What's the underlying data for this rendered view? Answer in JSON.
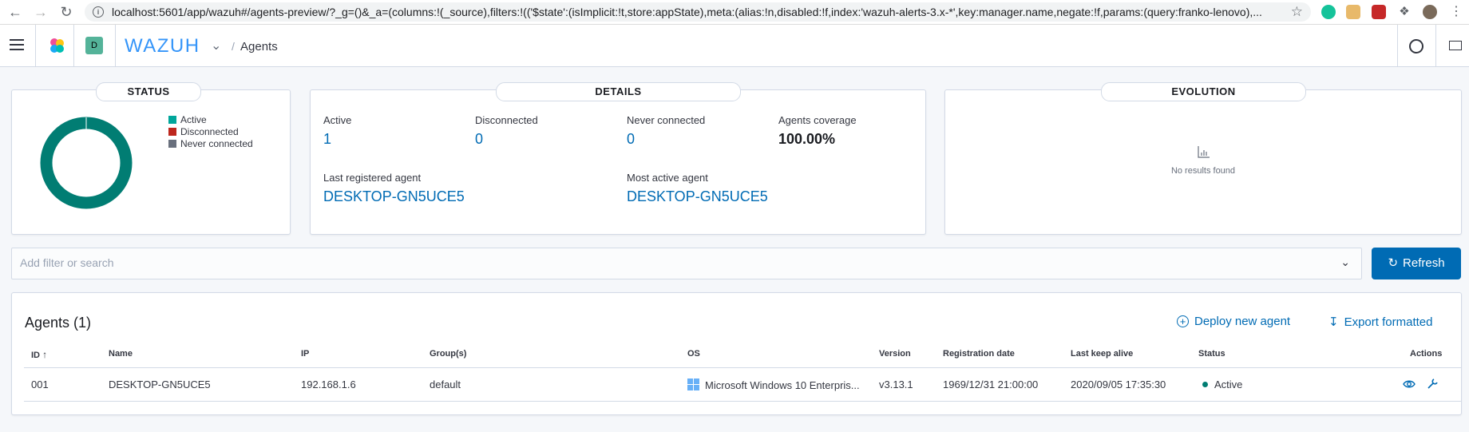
{
  "browser": {
    "url": "localhost:5601/app/wazuh#/agents-preview/?_g=()&_a=(columns:!(_source),filters:!(('$state':(isImplicit:!t,store:appState),meta:(alias:!n,disabled:!f,index:'wazuh-alerts-3.x-*',key:manager.name,negate:!f,params:(query:franko-lenovo),..."
  },
  "header": {
    "space_initial": "D",
    "brand": "WAZUH",
    "breadcrumb": "Agents"
  },
  "status_panel": {
    "title": "STATUS",
    "legend": [
      {
        "label": "Active",
        "color": "#00a69b"
      },
      {
        "label": "Disconnected",
        "color": "#bd271e"
      },
      {
        "label": "Never connected",
        "color": "#69707d"
      }
    ],
    "donut": {
      "active": 1,
      "disconnected": 0,
      "never_connected": 0,
      "color": "#017d73"
    }
  },
  "details_panel": {
    "title": "DETAILS",
    "stats": [
      {
        "label": "Active",
        "value": "1"
      },
      {
        "label": "Disconnected",
        "value": "0"
      },
      {
        "label": "Never connected",
        "value": "0"
      },
      {
        "label": "Agents coverage",
        "value": "100.00%"
      }
    ],
    "last_registered_label": "Last registered agent",
    "last_registered_value": "DESKTOP-GN5UCE5",
    "most_active_label": "Most active agent",
    "most_active_value": "DESKTOP-GN5UCE5"
  },
  "evolution_panel": {
    "title": "EVOLUTION",
    "empty_text": "No results found"
  },
  "search": {
    "placeholder": "Add filter or search"
  },
  "refresh_label": "Refresh",
  "agents": {
    "title": "Agents (1)",
    "deploy_label": "Deploy new agent",
    "export_label": "Export formatted",
    "columns": [
      "ID",
      "Name",
      "IP",
      "Group(s)",
      "OS",
      "Version",
      "Registration date",
      "Last keep alive",
      "Status",
      "Actions"
    ],
    "rows": [
      {
        "id": "001",
        "name": "DESKTOP-GN5UCE5",
        "ip": "192.168.1.6",
        "groups": "default",
        "os": "Microsoft Windows 10 Enterpris...",
        "version": "v3.13.1",
        "registration_date": "1969/12/31 21:00:00",
        "last_keep_alive": "2020/09/05 17:35:30",
        "status": "Active",
        "status_color": "#017d73"
      }
    ]
  }
}
